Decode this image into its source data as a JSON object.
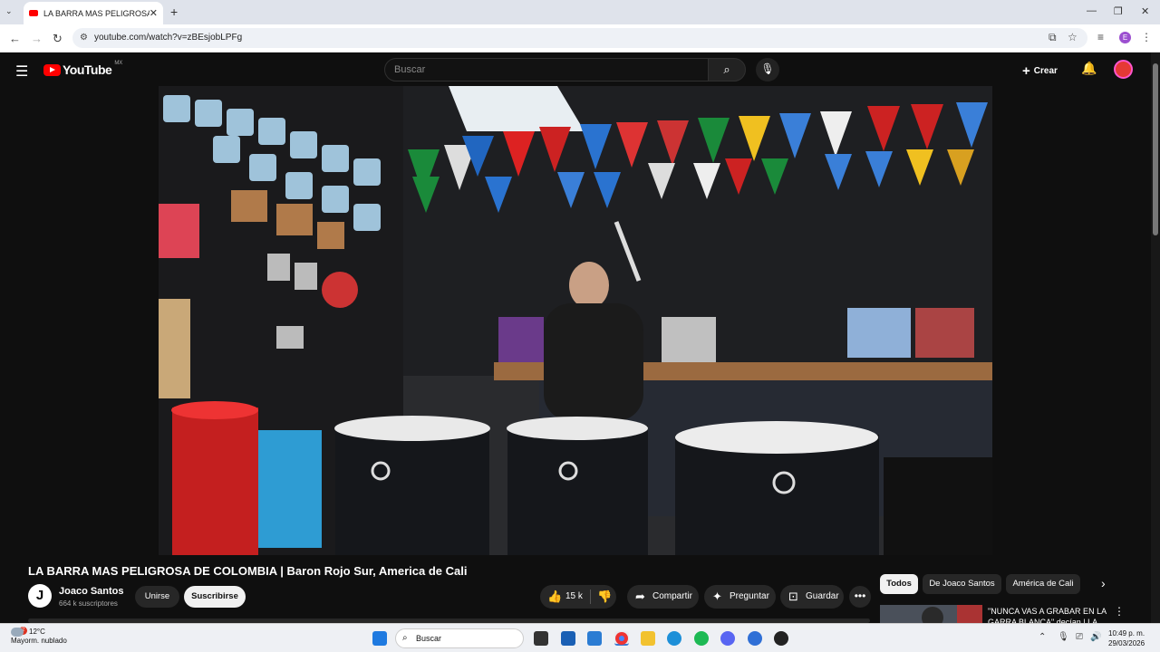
{
  "browser": {
    "tab_title": "LA BARRA MAS PELIGROSA DE",
    "url": "youtube.com/watch?v=zBEsjobLPFg",
    "profile_initial": "E"
  },
  "youtube": {
    "logo_text": "YouTube",
    "country": "MX",
    "search_placeholder": "Buscar",
    "create_label": "Crear"
  },
  "video": {
    "title": "LA BARRA MAS PELIGROSA DE COLOMBIA | Baron Rojo Sur, America de Cali",
    "channel_initial": "J",
    "channel_name": "Joaco Santos",
    "subscribers": "664 k suscriptores",
    "join_label": "Unirse",
    "subscribe_label": "Suscribirse",
    "likes": "15 k",
    "share_label": "Compartir",
    "ask_label": "Preguntar",
    "save_label": "Guardar"
  },
  "chips": [
    "Todos",
    "De Joaco Santos",
    "América de Cali"
  ],
  "recommendation": {
    "title": "\"NUNCA VAS A GRABAR EN LA GARRA BLANCA\" decían | LA"
  },
  "taskbar": {
    "temperature": "12°C",
    "weather": "Mayorm. nublado",
    "weather_badge": "2",
    "search_label": "Buscar",
    "time": "10:49 p. m.",
    "date": "29/03/2026"
  },
  "colors": {
    "brand_red": "#ff0000",
    "page_bg": "#0f0f0f"
  }
}
